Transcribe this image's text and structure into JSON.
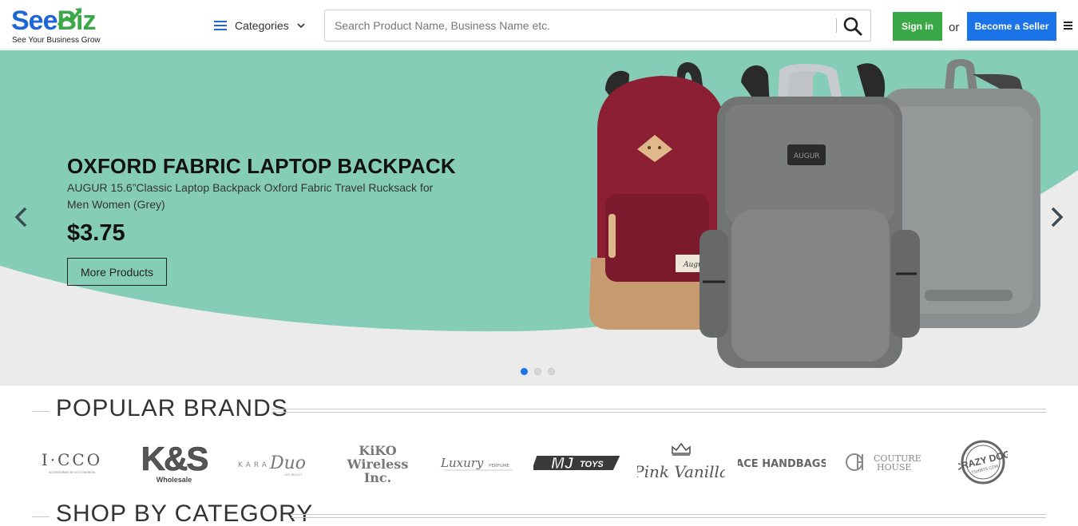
{
  "header": {
    "logo_part1": "See",
    "logo_part2": "Biz",
    "logo_tagline": "See Your Business Grow",
    "categories_label": "Categories",
    "search_placeholder": "Search Product Name, Business Name etc.",
    "signin_label": "Sign in",
    "or_label": "or",
    "seller_label": "Become a Seller",
    "colors": {
      "brand_blue": "#1e66d8",
      "brand_green": "#3aa847",
      "seller_blue": "#1a73e8"
    }
  },
  "hero": {
    "title": "OXFORD FABRIC LAPTOP BACKPACK",
    "description": "AUGUR 15.6”Classic Laptop Backpack Oxford Fabric Travel Rucksack for Men Women (Grey)",
    "price": "$3.75",
    "cta_label": "More Products",
    "bag_tag_text": "Augur",
    "bag_patch_text": "AUGUR",
    "slide_count": 3,
    "active_slide": 1,
    "colors": {
      "mint": "#86cdb8",
      "background": "#ebebeb"
    }
  },
  "brands_section": {
    "title": "POPULAR BRANDS",
    "brands": [
      {
        "name": "I·CCO",
        "subtext": "ACCESSORIES BY ICCO FASHION"
      },
      {
        "name": "K&S",
        "subtext": "Wholesale"
      },
      {
        "name_left": "KARA",
        "name_right": "Duo",
        "subtext": "LIFE BEAUTY"
      },
      {
        "name": "KiKO Wireless Inc."
      },
      {
        "name": "Luxury",
        "subtext": "PERFUME"
      },
      {
        "name": "MJ",
        "subtext": "TOYS"
      },
      {
        "name": "Pink Vanilla"
      },
      {
        "name": "ACE HANDBAGS"
      },
      {
        "name_top": "COUTURE",
        "name_bottom": "HOUSE"
      },
      {
        "name": "CRAZY DOG",
        "subtext": "TSHIRTS.COM"
      }
    ]
  },
  "category_section": {
    "title": "SHOP BY CATEGORY"
  }
}
